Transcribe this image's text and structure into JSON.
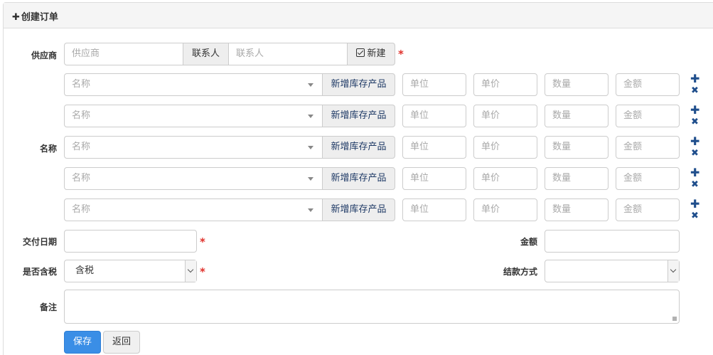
{
  "header": {
    "title": "创建订单"
  },
  "supplier": {
    "label": "供应商",
    "placeholder": "供应商",
    "contact_addon": "联系人",
    "contact_placeholder": "联系人",
    "new_label": "新建"
  },
  "items": {
    "label": "名称",
    "rows": [
      {
        "name_placeholder": "名称",
        "add_stock_label": "新增库存产品",
        "unit_placeholder": "单位",
        "price_placeholder": "单价",
        "qty_placeholder": "数量",
        "amount_placeholder": "金额"
      },
      {
        "name_placeholder": "名称",
        "add_stock_label": "新增库存产品",
        "unit_placeholder": "单位",
        "price_placeholder": "单价",
        "qty_placeholder": "数量",
        "amount_placeholder": "金额"
      },
      {
        "name_placeholder": "名称",
        "add_stock_label": "新增库存产品",
        "unit_placeholder": "单位",
        "price_placeholder": "单价",
        "qty_placeholder": "数量",
        "amount_placeholder": "金额"
      },
      {
        "name_placeholder": "名称",
        "add_stock_label": "新增库存产品",
        "unit_placeholder": "单位",
        "price_placeholder": "单价",
        "qty_placeholder": "数量",
        "amount_placeholder": "金额"
      },
      {
        "name_placeholder": "名称",
        "add_stock_label": "新增库存产品",
        "unit_placeholder": "单位",
        "price_placeholder": "单价",
        "qty_placeholder": "数量",
        "amount_placeholder": "金额"
      }
    ]
  },
  "delivery": {
    "label": "交付日期",
    "value": ""
  },
  "total": {
    "label": "金额",
    "value": ""
  },
  "tax": {
    "label": "是否含税",
    "value": "含税"
  },
  "payment": {
    "label": "结款方式",
    "value": ""
  },
  "note": {
    "label": "备注",
    "value": ""
  },
  "actions": {
    "save": "保存",
    "back": "返回"
  },
  "colors": {
    "accent": "#3a8ee6",
    "required": "#e0312b",
    "icon": "#1f4e8c"
  }
}
